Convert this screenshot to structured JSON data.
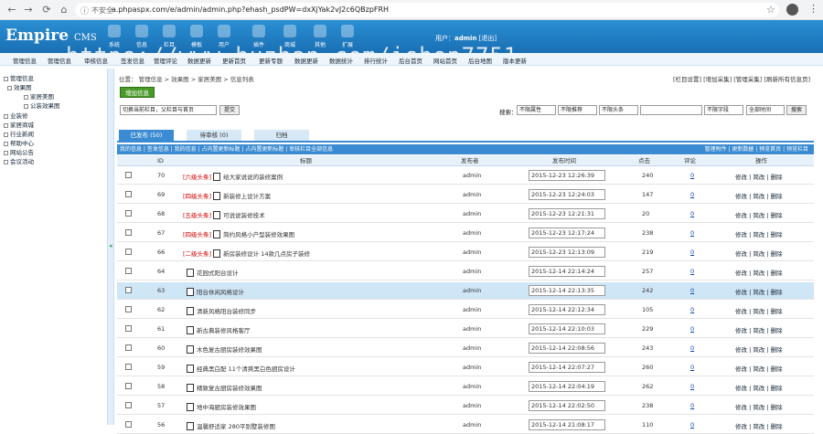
{
  "browser": {
    "insecure_label": "不安全",
    "url": "a.phpaspx.com/e/admin/admin.php?ehash_psdPW=dxXjYak2vJ2c6QBzpFRH"
  },
  "header": {
    "logo": "Empire",
    "logo_sub": "CMS",
    "watermark": "https://www.huzhan.com/ishop7751",
    "nav": [
      "系统",
      "信息",
      "栏目",
      "模板",
      "用户",
      "插件",
      "商城",
      "其他",
      "扩展"
    ],
    "user_label": "用户：",
    "user_name": "admin",
    "logout": "[退出]"
  },
  "subnav": [
    "管理信息",
    "管理信息",
    "审核信息",
    "签发信息",
    "管理评论",
    "数据更新",
    "更新首页",
    "更新专题",
    "数据更新",
    "数据统计",
    "排行统计",
    "后台首页",
    "网站首页",
    "后台地图",
    "版本更新"
  ],
  "sidebar": {
    "root": "管理信息",
    "items": [
      "效果图",
      "家居美图",
      "公装效果图",
      "业装修",
      "家居商城",
      "行业新闻",
      "帮助中心",
      "网站公告",
      "会议活动"
    ]
  },
  "main": {
    "crumb": "位置： 管理信息 > 效果图 > 家居美图 > 信息列表",
    "right_links": "[栏目设置] [增加采集] [管理采集] [刷新所有信息页]",
    "add_button": "增加信息",
    "column_select": "切换当前栏目，父栏目与首页",
    "submit": "提交",
    "search_label": "搜索：",
    "search_selects": [
      "不限属性",
      "不限推荐",
      "不限头条"
    ],
    "field_select": "不限字段",
    "time_select": "全部时间",
    "search_button": "搜索",
    "tabs": [
      "已发布 (50)",
      "待审核 (0)",
      "归档"
    ],
    "filter_left": "我的信息 | 签发信息 | 我的信息 | 占内置更新标题 | 占内置更新标题 | 审核栏目全部信息",
    "filter_right": "管理附件 | 更新数据 | 预览首页 | 预览栏目",
    "headers": [
      "ID",
      "标题",
      "发布者",
      "发布时间",
      "点击",
      "评论",
      "操作"
    ],
    "ops": "修改 | 简改 | 删除"
  },
  "rows": [
    {
      "id": "70",
      "tag": "[六级头条]",
      "title": "给大家说说的装修案例",
      "author": "admin",
      "time": "2015-12-23 12:26:39",
      "clicks": "240",
      "comments": "0",
      "hl": false
    },
    {
      "id": "69",
      "tag": "[四级头条]",
      "title": "新装修上设计方案",
      "author": "admin",
      "time": "2015-12-23 12:24:03",
      "clicks": "147",
      "comments": "0",
      "hl": false
    },
    {
      "id": "68",
      "tag": "[五级头条]",
      "title": "可说说装修技术",
      "author": "admin",
      "time": "2015-12-23 12:21:31",
      "clicks": "20",
      "comments": "0",
      "hl": false
    },
    {
      "id": "67",
      "tag": "[四级头条]",
      "title": "简约风格小户型装修效果图",
      "author": "admin",
      "time": "2015-12-23 12:17:24",
      "clicks": "238",
      "comments": "0",
      "hl": false
    },
    {
      "id": "66",
      "tag": "[二级头条]",
      "title": "新房装修设计 14款几点房子装修",
      "author": "admin",
      "time": "2015-12-23 12:13:09",
      "clicks": "219",
      "comments": "0",
      "hl": false
    },
    {
      "id": "64",
      "tag": "",
      "title": "花园式阳台设计",
      "author": "admin",
      "time": "2015-12-14 22:14:24",
      "clicks": "257",
      "comments": "0",
      "hl": false
    },
    {
      "id": "63",
      "tag": "",
      "title": "阳台休闲风格设计",
      "author": "admin",
      "time": "2015-12-14 22:13:35",
      "clicks": "242",
      "comments": "0",
      "hl": true
    },
    {
      "id": "62",
      "tag": "",
      "title": "清新风格阳台装修同步",
      "author": "admin",
      "time": "2015-12-14 22:12:34",
      "clicks": "105",
      "comments": "0",
      "hl": false
    },
    {
      "id": "61",
      "tag": "",
      "title": "新古典装修风格客厅",
      "author": "admin",
      "time": "2015-12-14 22:10:03",
      "clicks": "229",
      "comments": "0",
      "hl": false
    },
    {
      "id": "60",
      "tag": "",
      "title": "木色复古厨房装修效果图",
      "author": "admin",
      "time": "2015-12-14 22:08:56",
      "clicks": "243",
      "comments": "0",
      "hl": false
    },
    {
      "id": "59",
      "tag": "",
      "title": "经典黑白配 11个清爽黑白色厨房设计",
      "author": "admin",
      "time": "2015-12-14 22:07:27",
      "clicks": "260",
      "comments": "0",
      "hl": false
    },
    {
      "id": "58",
      "tag": "",
      "title": "精致复古厨房装修效果图",
      "author": "admin",
      "time": "2015-12-14 22:04:19",
      "clicks": "262",
      "comments": "0",
      "hl": false
    },
    {
      "id": "57",
      "tag": "",
      "title": "地中海厨房装修效果图",
      "author": "admin",
      "time": "2015-12-14 22:02:50",
      "clicks": "238",
      "comments": "0",
      "hl": false
    },
    {
      "id": "56",
      "tag": "",
      "title": "温馨舒适家 280平别墅装修图",
      "author": "admin",
      "time": "2015-12-14 21:08:17",
      "clicks": "110",
      "comments": "0",
      "hl": false
    }
  ]
}
